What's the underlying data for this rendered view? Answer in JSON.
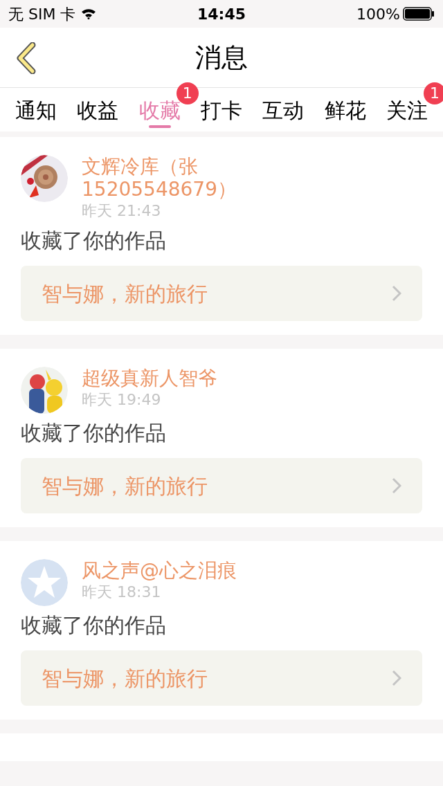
{
  "status_bar": {
    "carrier": "无 SIM 卡",
    "time": "14:45",
    "battery": "100%"
  },
  "header": {
    "title": "消息"
  },
  "tabs": [
    {
      "label": "通知",
      "selected": false
    },
    {
      "label": "收益",
      "selected": false
    },
    {
      "label": "收藏",
      "selected": true,
      "badge": "1"
    },
    {
      "label": "打卡",
      "selected": false
    },
    {
      "label": "互动",
      "selected": false
    },
    {
      "label": "鲜花",
      "selected": false
    },
    {
      "label": "关注",
      "selected": false,
      "badge": "1"
    }
  ],
  "messages": [
    {
      "name": "文辉冷库（张15205548679）",
      "time": "昨天 21:43",
      "text": "收藏了你的作品",
      "link": "智与娜，新的旅行"
    },
    {
      "name": "超级真新人智爷",
      "time": "昨天 19:49",
      "text": "收藏了你的作品",
      "link": "智与娜，新的旅行"
    },
    {
      "name": "风之声@心之泪痕",
      "time": "昨天 18:31",
      "text": "收藏了你的作品",
      "link": "智与娜，新的旅行"
    }
  ]
}
